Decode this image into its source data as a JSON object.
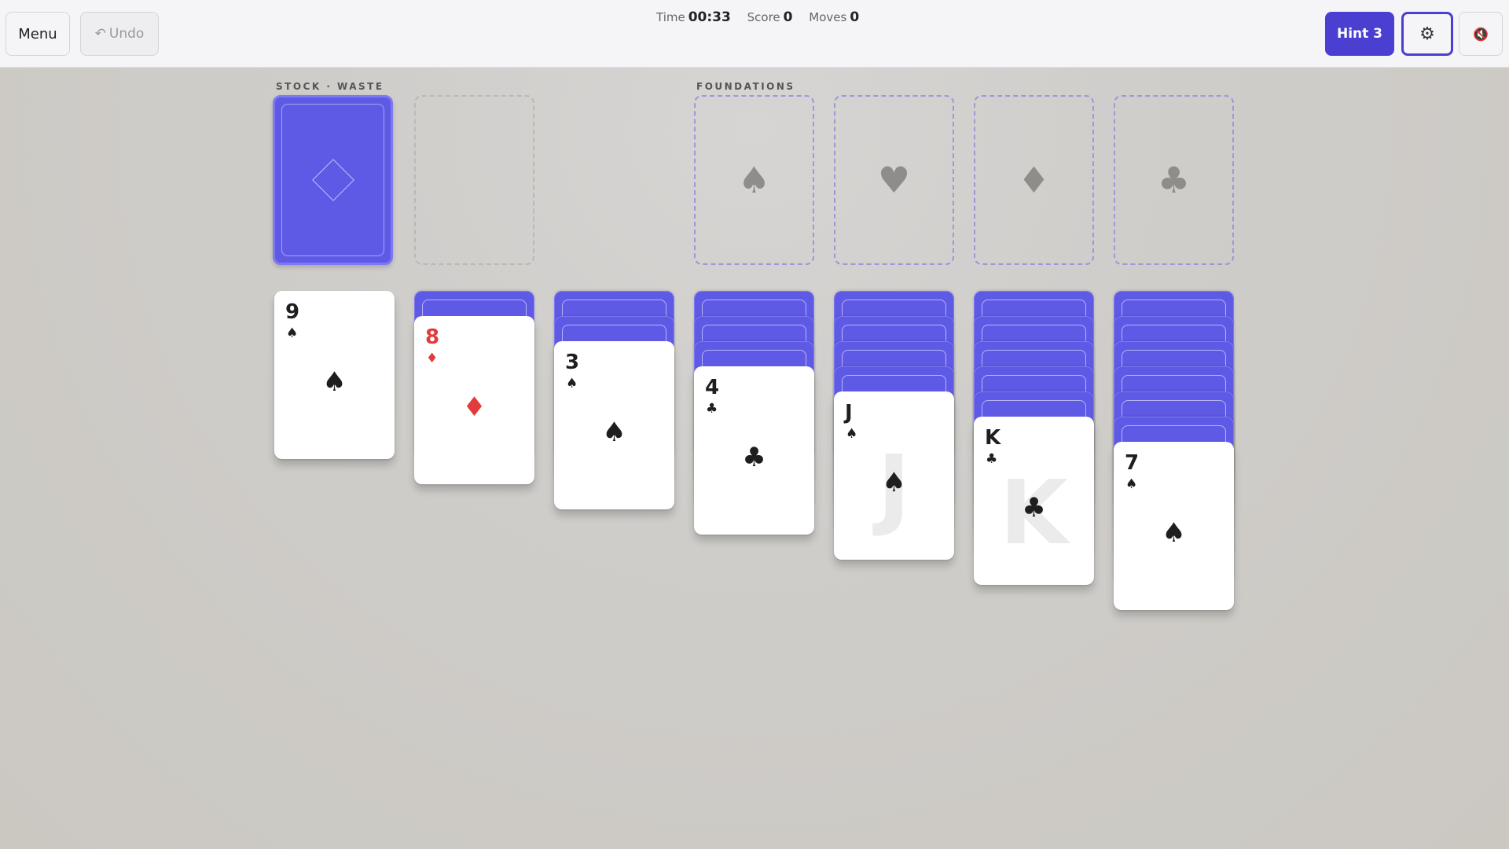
{
  "toolbar": {
    "menu_label": "Menu",
    "undo_label": "Undo",
    "undo_icon": "↶",
    "hint_label": "Hint 3",
    "settings_icon": "⚙",
    "sound_icon": "🔇"
  },
  "stats": {
    "time_label": "Time",
    "time_value": "00:33",
    "score_label": "Score",
    "score_value": "0",
    "moves_label": "Moves",
    "moves_value": "0"
  },
  "labels": {
    "stock_waste": "STOCK · WASTE",
    "foundations": "FOUNDATIONS"
  },
  "foundations": [
    "♠",
    "♥",
    "♦",
    "♣"
  ],
  "tableau": [
    {
      "face_down": 0,
      "rank": "9",
      "suit": "♠",
      "color": "black",
      "watermark": ""
    },
    {
      "face_down": 1,
      "rank": "8",
      "suit": "♦",
      "color": "red",
      "watermark": ""
    },
    {
      "face_down": 2,
      "rank": "3",
      "suit": "♠",
      "color": "black",
      "watermark": ""
    },
    {
      "face_down": 3,
      "rank": "4",
      "suit": "♣",
      "color": "black",
      "watermark": ""
    },
    {
      "face_down": 4,
      "rank": "J",
      "suit": "♠",
      "color": "black",
      "watermark": "J"
    },
    {
      "face_down": 5,
      "rank": "K",
      "suit": "♣",
      "color": "black",
      "watermark": "K"
    },
    {
      "face_down": 6,
      "rank": "7",
      "suit": "♠",
      "color": "black",
      "watermark": ""
    }
  ]
}
